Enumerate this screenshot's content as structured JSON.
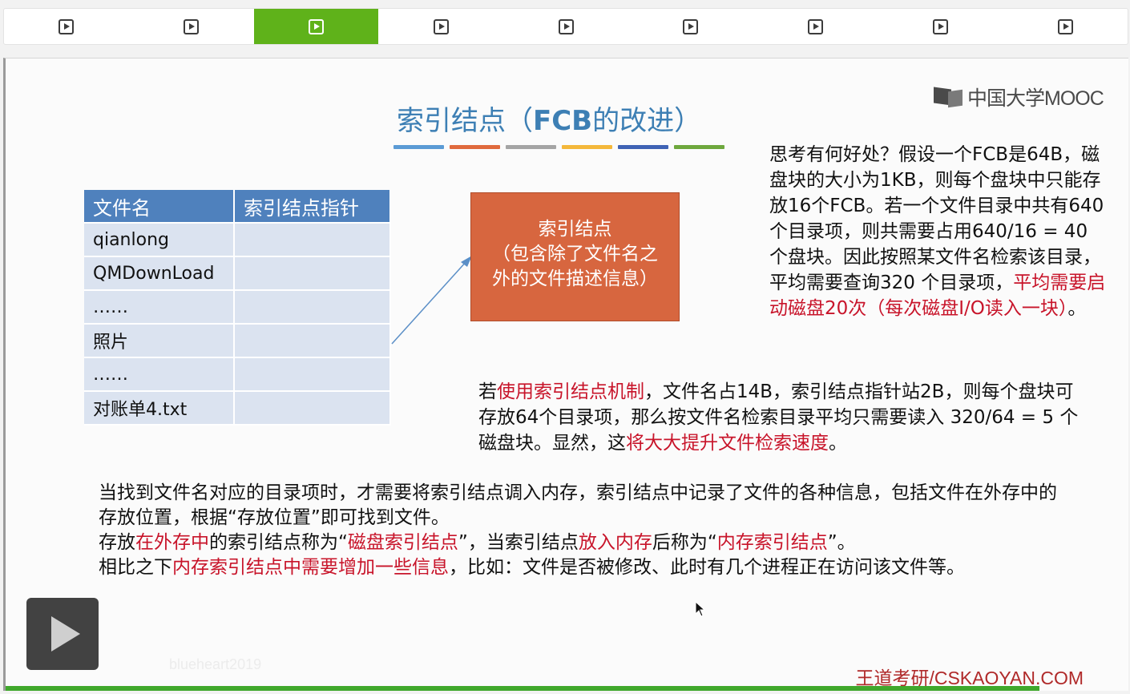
{
  "nav": {
    "items": [
      {
        "icon": "play-icon",
        "active": false
      },
      {
        "icon": "play-icon",
        "active": false
      },
      {
        "icon": "play-icon",
        "active": true
      },
      {
        "icon": "play-icon",
        "active": false
      },
      {
        "icon": "play-icon",
        "active": false
      },
      {
        "icon": "play-icon",
        "active": false
      },
      {
        "icon": "play-icon",
        "active": false
      },
      {
        "icon": "play-icon",
        "active": false
      },
      {
        "icon": "play-icon",
        "active": false
      }
    ]
  },
  "slide": {
    "logo_text": "中国大学MOOC",
    "title_prefix": "索引结点（",
    "title_fcb": "FCB",
    "title_suffix": "的改进）",
    "color_bar": [
      "#5b9bd5",
      "#e06a3d",
      "#a5a5a5",
      "#f4b83a",
      "#3f63b5",
      "#6ea83d"
    ],
    "table": {
      "headers": [
        "文件名",
        "索引结点指针"
      ],
      "rows": [
        "qianlong",
        "QMDownLoad",
        "……",
        "照片",
        "……",
        "对账单4.txt"
      ]
    },
    "inode_box": {
      "line1": "索引结点",
      "line2": "（包含除了文件名之",
      "line3": "外的文件描述信息）"
    },
    "think": {
      "seg1": "思考有何好处？假设一个FCB是64B，磁盘块的大小为1KB，则每个盘块中只能存放16个FCB。若一个文件目录中共有640个目录项，则共需要占用640/16 = 40 个盘块。因此按照某文件名检索该目录，平均需要查询320 个目录项，",
      "red1": "平均需要启动磁盘20次（每次磁盘I/O读入一块）",
      "seg2": "。"
    },
    "index_para": {
      "seg1": "若",
      "red1": "使用索引结点机制",
      "seg2": "，文件名占14B，索引结点指针站2B，则每个盘块可存放64个目录项，那么按文件名检索目录平均只需要读入 320/64 = 5 个磁盘块。显然，这",
      "red2": "将大大提升文件检索速度",
      "seg3": "。"
    },
    "bottom": {
      "line1": "当找到文件名对应的目录项时，才需要将索引结点调入内存，索引结点中记录了文件的各种信息，包括文件在外存中的存放位置，根据“存放位置”即可找到文件。",
      "l2_seg1": "存放",
      "l2_red1": "在外存中",
      "l2_seg2": "的索引结点称为“",
      "l2_red2": "磁盘索引结点",
      "l2_seg3": "”，当索引结点",
      "l2_red3": "放入内存",
      "l2_seg4": "后称为“",
      "l2_red4": "内存索引结点",
      "l2_seg5": "”。",
      "l3_seg1": "相比之下",
      "l3_red1": "内存索引结点中需要增加一些信息",
      "l3_seg2": "，比如：文件是否被修改、此时有几个进程正在访问该文件等。"
    },
    "watermark": "blueheart2019",
    "footer_brand": "王道考研/CSKAOYAN.COM"
  }
}
